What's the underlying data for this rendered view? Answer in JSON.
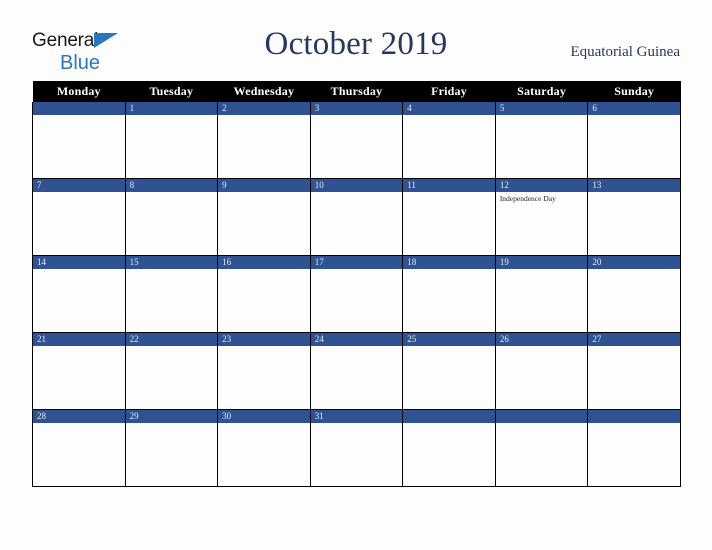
{
  "brand": {
    "line1": "General",
    "line2": "Blue",
    "triangle_color": "#2878be",
    "text_color": "#1a1a1a"
  },
  "header": {
    "title": "October 2019",
    "country": "Equatorial Guinea",
    "title_color": "#28375e"
  },
  "colors": {
    "header_row_bg": "#000000",
    "header_row_text": "#ffffff",
    "date_band_bg": "#2e5292",
    "date_band_text": "#e8eaf0",
    "cell_bg": "#fdfdfd",
    "grid_line": "#000000",
    "page_bg": "#fdfdfd"
  },
  "weekdays": [
    "Monday",
    "Tuesday",
    "Wednesday",
    "Thursday",
    "Friday",
    "Saturday",
    "Sunday"
  ],
  "weeks": [
    [
      {
        "day": "",
        "events": []
      },
      {
        "day": "1",
        "events": []
      },
      {
        "day": "2",
        "events": []
      },
      {
        "day": "3",
        "events": []
      },
      {
        "day": "4",
        "events": []
      },
      {
        "day": "5",
        "events": []
      },
      {
        "day": "6",
        "events": []
      }
    ],
    [
      {
        "day": "7",
        "events": []
      },
      {
        "day": "8",
        "events": []
      },
      {
        "day": "9",
        "events": []
      },
      {
        "day": "10",
        "events": []
      },
      {
        "day": "11",
        "events": []
      },
      {
        "day": "12",
        "events": [
          "Independence Day"
        ]
      },
      {
        "day": "13",
        "events": []
      }
    ],
    [
      {
        "day": "14",
        "events": []
      },
      {
        "day": "15",
        "events": []
      },
      {
        "day": "16",
        "events": []
      },
      {
        "day": "17",
        "events": []
      },
      {
        "day": "18",
        "events": []
      },
      {
        "day": "19",
        "events": []
      },
      {
        "day": "20",
        "events": []
      }
    ],
    [
      {
        "day": "21",
        "events": []
      },
      {
        "day": "22",
        "events": []
      },
      {
        "day": "23",
        "events": []
      },
      {
        "day": "24",
        "events": []
      },
      {
        "day": "25",
        "events": []
      },
      {
        "day": "26",
        "events": []
      },
      {
        "day": "27",
        "events": []
      }
    ],
    [
      {
        "day": "28",
        "events": []
      },
      {
        "day": "29",
        "events": []
      },
      {
        "day": "30",
        "events": []
      },
      {
        "day": "31",
        "events": []
      },
      {
        "day": "",
        "events": []
      },
      {
        "day": "",
        "events": []
      },
      {
        "day": "",
        "events": []
      }
    ]
  ]
}
